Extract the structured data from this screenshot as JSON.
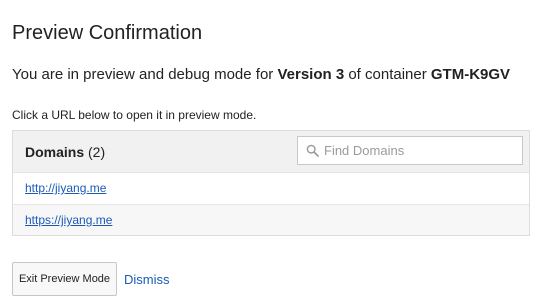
{
  "dialog": {
    "title": "Preview Confirmation",
    "summary": {
      "prefix": "You are in preview and debug mode for ",
      "version": "Version 3",
      "middle": " of container ",
      "container": "GTM-K9GV"
    },
    "instruction": "Click a URL below to open it in preview mode."
  },
  "domains": {
    "heading": "Domains",
    "count": "(2)",
    "search": {
      "placeholder": "Find Domains",
      "value": "",
      "icon": "search-icon"
    },
    "items": [
      {
        "url": "http://jiyang.me"
      },
      {
        "url": "https://jiyang.me"
      }
    ]
  },
  "actions": {
    "exit_label": "Exit Preview Mode",
    "dismiss_label": "Dismiss"
  },
  "colors": {
    "link": "#1a5bb8",
    "header_bg": "#f1f1f1",
    "border": "#dcdcdc"
  }
}
